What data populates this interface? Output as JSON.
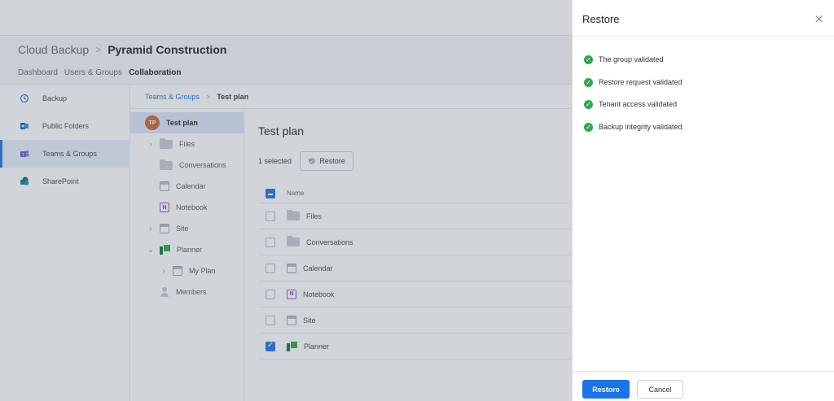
{
  "header": {
    "root": "Cloud Backup",
    "current": "Pyramid Construction",
    "tabs": [
      "Dashboard",
      "Users & Groups",
      "Collaboration"
    ],
    "active_tab": "Collaboration"
  },
  "sidebar": {
    "items": [
      {
        "label": "Backup",
        "icon": "history-icon"
      },
      {
        "label": "Public Folders",
        "icon": "outlook-icon"
      },
      {
        "label": "Teams & Groups",
        "icon": "teams-icon"
      },
      {
        "label": "SharePoint",
        "icon": "sharepoint-icon"
      }
    ],
    "active": "Teams & Groups"
  },
  "crumb": {
    "parent": "Teams & Groups",
    "current": "Test plan"
  },
  "tree": {
    "root_initials": "TP",
    "root_label": "Test plan",
    "items": [
      {
        "label": "Files",
        "icon": "folder-icon",
        "expandable": true
      },
      {
        "label": "Conversations",
        "icon": "folder-icon",
        "expandable": false
      },
      {
        "label": "Calendar",
        "icon": "calendar-icon",
        "expandable": false
      },
      {
        "label": "Notebook",
        "icon": "notebook-icon",
        "expandable": false
      },
      {
        "label": "Site",
        "icon": "site-icon",
        "expandable": true
      },
      {
        "label": "Planner",
        "icon": "planner-icon",
        "expandable": true,
        "expanded": true
      },
      {
        "label": "My Plan",
        "icon": "calendar-icon",
        "expandable": true
      },
      {
        "label": "Members",
        "icon": "members-icon",
        "expandable": false
      }
    ]
  },
  "main": {
    "title": "Test plan",
    "selected_text": "1 selected",
    "restore_label": "Restore",
    "column_name": "Name",
    "rows": [
      {
        "label": "Files",
        "checked": false
      },
      {
        "label": "Conversations",
        "checked": false
      },
      {
        "label": "Calendar",
        "checked": false
      },
      {
        "label": "Notebook",
        "checked": false
      },
      {
        "label": "Site",
        "checked": false
      },
      {
        "label": "Planner",
        "checked": true
      }
    ]
  },
  "panel": {
    "title": "Restore",
    "checks": [
      "The group validated",
      "Restore request validated",
      "Tenant access validated",
      "Backup integrity validated"
    ],
    "restore_button": "Restore",
    "cancel_button": "Cancel"
  },
  "colors": {
    "accent": "#1a73e8",
    "success": "#2fa84f",
    "avatar": "#c8683a"
  }
}
